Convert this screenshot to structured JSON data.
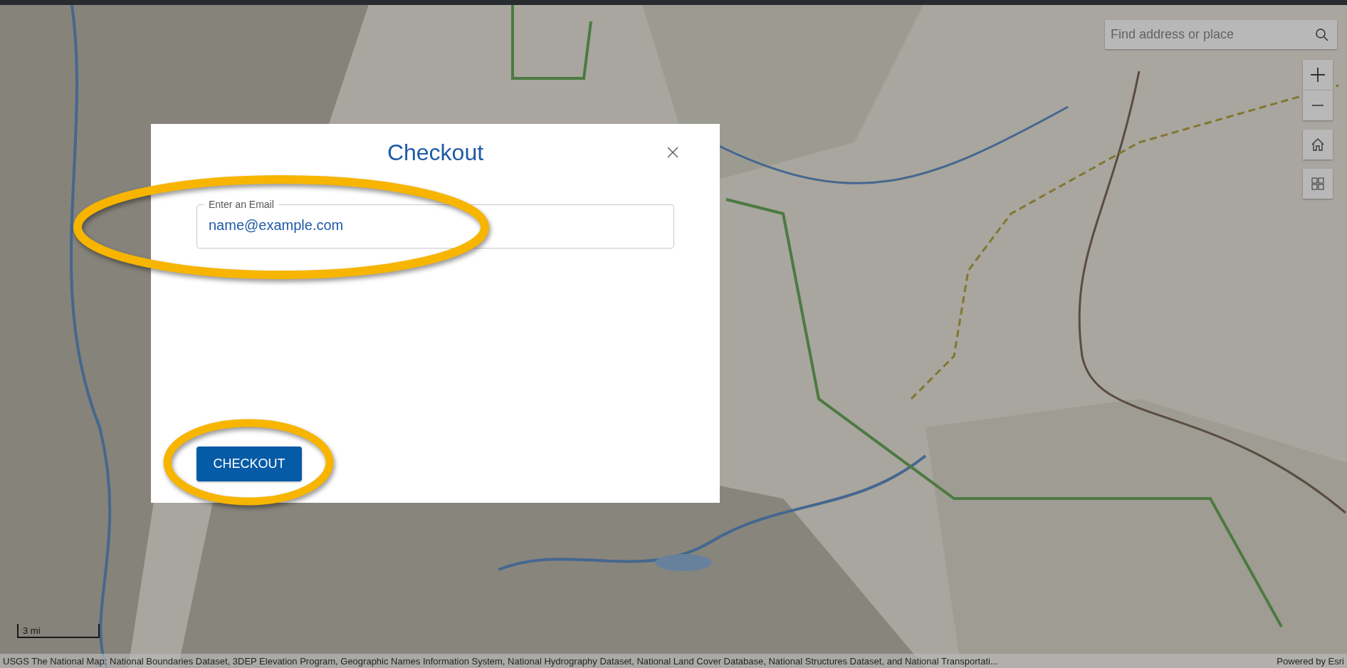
{
  "search": {
    "placeholder": "Find address or place"
  },
  "scale_bar": {
    "label": "3 mi"
  },
  "attribution": {
    "text": "USGS The National Map: National Boundaries Dataset, 3DEP Elevation Program, Geographic Names Information System, National Hydrography Dataset, National Land Cover Database, National Structures Dataset, and National Transportati...",
    "powered_by": "Powered by Esri"
  },
  "dialog": {
    "title": "Checkout",
    "email_field": {
      "label": "Enter an Email",
      "value": "name@example.com"
    },
    "button": "CHECKOUT"
  }
}
